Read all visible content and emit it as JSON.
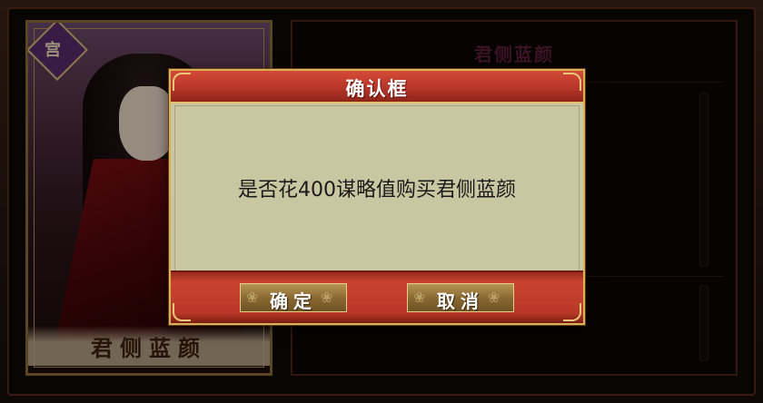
{
  "background": {
    "card_badge": "宫",
    "card_name": "君侧蓝颜",
    "panel_title": "君侧蓝颜"
  },
  "dialog": {
    "title": "确认框",
    "message": "是否花400谋略值购买君侧蓝颜",
    "confirm_label": "确定",
    "cancel_label": "取消"
  },
  "colors": {
    "titlebar": "#c03a2c",
    "body": "#c9c6a2",
    "button": "#8a6a32",
    "border_gold": "#d6b25c"
  }
}
